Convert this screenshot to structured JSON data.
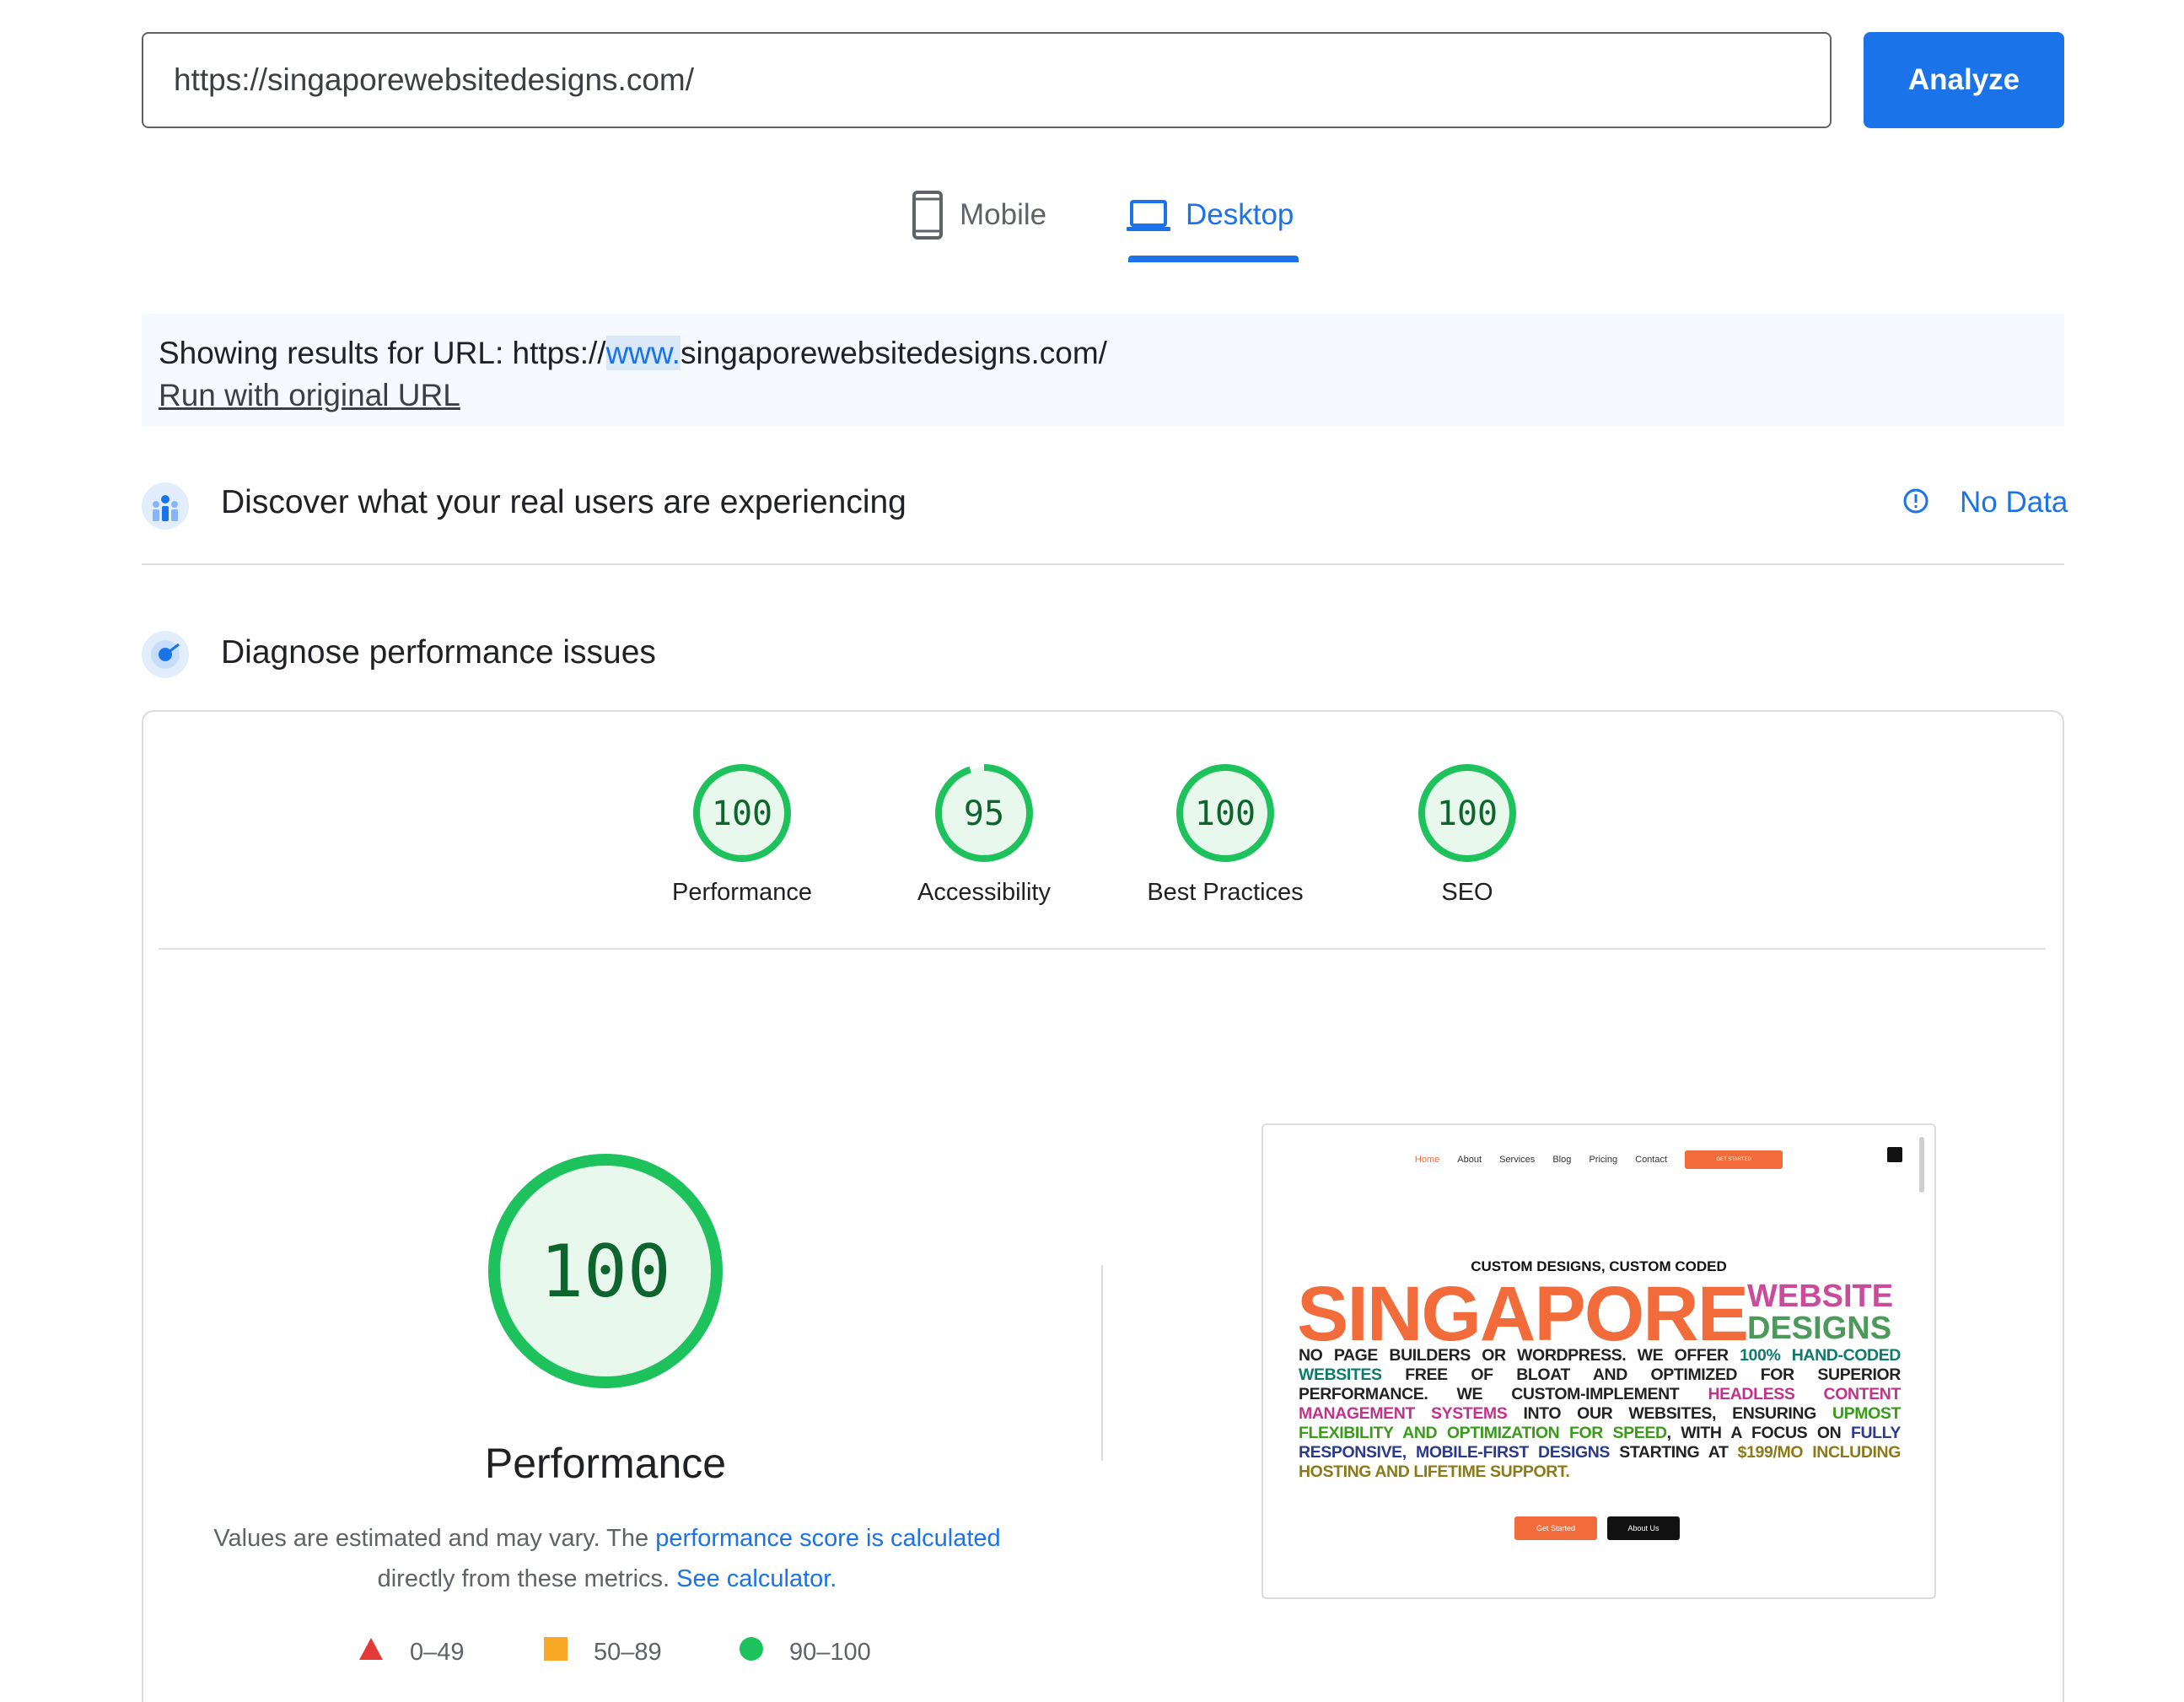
{
  "search": {
    "url_value": "https://singaporewebsitedesigns.com/",
    "analyze_label": "Analyze"
  },
  "tabs": [
    {
      "label": "Mobile",
      "icon": "smartphone-icon",
      "active": false
    },
    {
      "label": "Desktop",
      "icon": "laptop-icon",
      "active": true
    }
  ],
  "notice": {
    "prefix": "Showing results for URL: https://",
    "highlight": "www.",
    "suffix": "singaporewebsitedesigns.com/",
    "run_original_label": "Run with original URL"
  },
  "field_data": {
    "title": "Discover what your real users are experiencing",
    "icon": "crux-users-icon",
    "status_icon": "info-icon",
    "status_label": "No Data"
  },
  "lab": {
    "title": "Diagnose performance issues",
    "icon": "lighthouse-radar-icon"
  },
  "scores": [
    {
      "label": "Performance",
      "value": "100",
      "fraction": 1.0
    },
    {
      "label": "Accessibility",
      "value": "95",
      "fraction": 0.95
    },
    {
      "label": "Best Practices",
      "value": "100",
      "fraction": 1.0
    },
    {
      "label": "SEO",
      "value": "100",
      "fraction": 1.0
    }
  ],
  "performance": {
    "score": "100",
    "fraction": 1.0,
    "title": "Performance",
    "desc_1": "Values are estimated and may vary. The ",
    "desc_link_1": "performance score is calculated",
    "desc_2": "directly from these metrics. ",
    "desc_link_2": "See calculator."
  },
  "legend": [
    {
      "range": "0–49",
      "shape": "triangle",
      "color": "#e53935"
    },
    {
      "range": "50–89",
      "shape": "square",
      "color": "#f9a825"
    },
    {
      "range": "90–100",
      "shape": "circle",
      "color": "#1ec25c"
    }
  ],
  "colors": {
    "accent": "#1a73e8",
    "pass_ring": "#1ec25c",
    "pass_fill": "#e8f8ec",
    "pass_text": "#0d652d",
    "brand_orange": "#f26b3a"
  },
  "thumbnail": {
    "nav": [
      "Home",
      "About",
      "Services",
      "Blog",
      "Pricing",
      "Contact"
    ],
    "nav_cta": "GET STARTED",
    "subheading": "CUSTOM DESIGNS, CUSTOM CODED",
    "headline": "SINGAPORE",
    "headline_2a": "WEBSITE",
    "headline_2b": "DESIGNS",
    "body": {
      "p1": "NO PAGE BUILDERS OR WORDPRESS. WE OFFER ",
      "h1": "100% HAND-CODED WEBSITES",
      "p2": " FREE OF BLOAT AND OPTIMIZED FOR SUPERIOR PERFORMANCE. WE CUSTOM-IMPLEMENT ",
      "h2": "HEADLESS CONTENT MANAGEMENT SYSTEMS",
      "p3": " INTO OUR WEBSITES, ENSURING ",
      "h3": "UPMOST FLEXIBILITY AND OPTIMIZATION FOR SPEED",
      "p4": ", WITH A FOCUS ON ",
      "h4": "FULLY RESPONSIVE, MOBILE-FIRST DESIGNS",
      "p5": " STARTING AT ",
      "h5": "$199/MO INCLUDING HOSTING AND LIFETIME SUPPORT."
    },
    "btn_primary": "Get Started",
    "btn_secondary": "About Us"
  }
}
